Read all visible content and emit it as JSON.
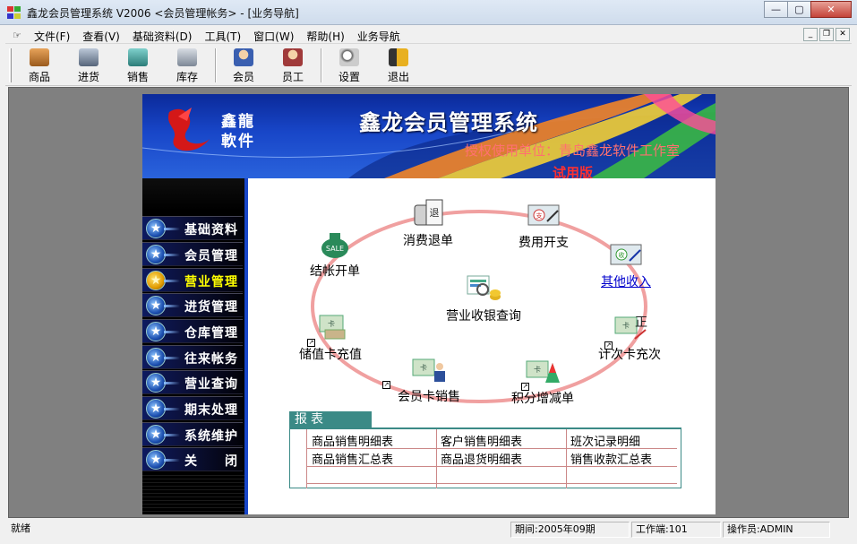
{
  "window": {
    "title": "鑫龙会员管理系统 V2006 <会员管理帐务> - [业务导航]"
  },
  "menubar": [
    "文件(F)",
    "查看(V)",
    "基础资料(D)",
    "工具(T)",
    "窗口(W)",
    "帮助(H)",
    "业务导航"
  ],
  "toolbar": {
    "group1": [
      "商品",
      "进货",
      "销售",
      "库存"
    ],
    "group2": [
      "会员",
      "员工"
    ],
    "group3": [
      "设置",
      "退出"
    ]
  },
  "banner": {
    "logo_line1": "鑫龍",
    "logo_line2": "軟件",
    "system_title": "鑫龙会员管理系统",
    "authorization": "授权使用单位：青岛鑫龙软件工作室",
    "trial": "试用版"
  },
  "sidebar": {
    "items": [
      "基础资料",
      "会员管理",
      "营业管理",
      "进货管理",
      "仓库管理",
      "往来帐务",
      "营业查询",
      "期末处理",
      "系统维护",
      "关　　闭"
    ],
    "active_index": 2
  },
  "flow": {
    "checkout": "结帐开单",
    "refund": "消费退单",
    "expense": "费用开支",
    "other_income": "其他收入",
    "cashier_query": "营业收银查询",
    "stored_card_topup": "储值卡充值",
    "count_card_topup": "计次卡充次",
    "card_sale": "会员卡销售",
    "points_adjust": "积分增减单"
  },
  "report": {
    "tab": "报表",
    "rows": [
      [
        "商品销售明细表",
        "客户销售明细表",
        "班次记录明细"
      ],
      [
        "商品销售汇总表",
        "商品退货明细表",
        "销售收款汇总表"
      ]
    ]
  },
  "statusbar": {
    "ready": "就绪",
    "period": "期间:2005年09期",
    "terminal": "工作端:101",
    "operator": "操作员:ADMIN"
  },
  "colors": {
    "accent": "#1846c8",
    "active_nav": "#ffff00",
    "ring": "#f0a0a0"
  }
}
